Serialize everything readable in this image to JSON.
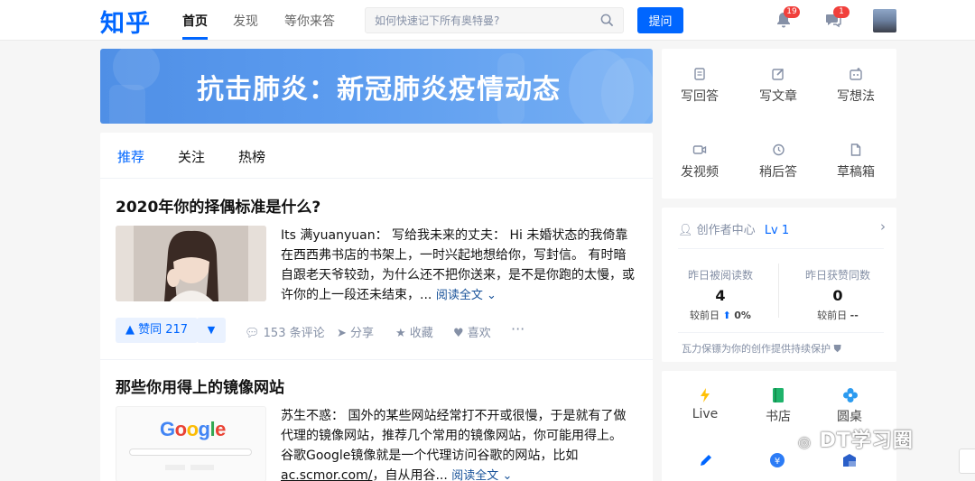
{
  "header": {
    "logo": "知乎",
    "nav": [
      "首页",
      "发现",
      "等你来答"
    ],
    "search_placeholder": "如何快速记下所有奥特曼?",
    "ask_label": "提问",
    "notifications_count": "19",
    "messages_count": "1"
  },
  "banner": {
    "title": "抗击肺炎：新冠肺炎疫情动态"
  },
  "feed": {
    "tabs": [
      "推荐",
      "关注",
      "热榜"
    ],
    "cards": [
      {
        "title": "2020年你的择偶标准是什么?",
        "excerpt": "Its 满yuanyuan： 写给我未来的丈夫： Hi 未婚状态的我倚靠在西西弗书店的书架上，一时兴起地想给你，写封信。 有时暗自跟老天爷较劲，为什么还不把你送来，是不是你跑的太慢，或许你的上一段还未结束，...",
        "read_more": "阅读全文",
        "vote_label": "▲ 赞同 217",
        "comments": "153 条评论",
        "share": "分享",
        "favorite": "收藏",
        "like": "喜欢"
      },
      {
        "title": "那些你用得上的镜像网站",
        "excerpt_1": "苏生不惑： 国外的某些网站经常打不开或很慢，于是就有了做代理的镜像网站，推荐几个常用的镜像网站，你可能用得上。 谷歌Google镜像就是一个代理访问谷歌的网站，比如",
        "link": "ac.scmor.com/",
        "excerpt_2": "，自从用谷...",
        "read_more": "阅读全文",
        "thumb_logo": "Google"
      }
    ]
  },
  "sidebar": {
    "write_buttons": [
      "写回答",
      "写文章",
      "写想法",
      "发视频",
      "稍后答",
      "草稿箱"
    ],
    "creator": {
      "title": "创作者中心",
      "level": "Lv 1",
      "stat1_label": "昨日被阅读数",
      "stat1_value": "4",
      "stat1_compare_label": "较前日",
      "stat1_compare_value": "0%",
      "stat2_label": "昨日获赞同数",
      "stat2_value": "0",
      "stat2_compare_label": "较前日",
      "stat2_compare_value": "--",
      "footer": "瓦力保镖为你的创作提供持续保护"
    },
    "apps": [
      "Live",
      "书店",
      "圆桌"
    ]
  },
  "watermark": "DT学习圈",
  "colors": {
    "brand": "#0066ff",
    "badge": "#f1403c"
  }
}
